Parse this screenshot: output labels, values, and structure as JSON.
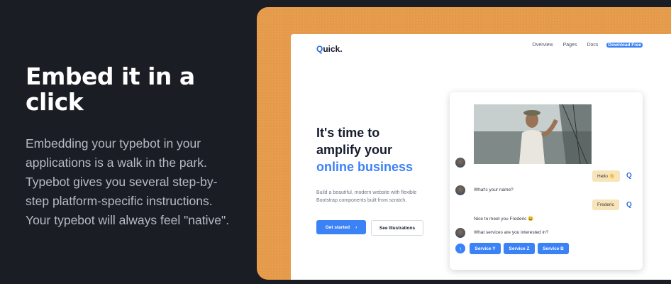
{
  "section": {
    "title": "Embed it in a click",
    "description": "Embedding your typebot in your applications is a walk in the park. Typebot gives you several step-by-step platform-specific instructions. Your typebot will always feel \"native\"."
  },
  "site": {
    "logo_q": "Q",
    "logo_rest": "uick.",
    "nav": {
      "overview": "Overview",
      "pages": "Pages",
      "docs": "Docs",
      "download": "Download Free"
    },
    "hero": {
      "line1": "It's time to",
      "line2": "amplify your",
      "line3": "online business",
      "subtitle": "Build a beautiful, modern website with flexible Bootstrap components built from scratch.",
      "cta_primary": "Get started",
      "cta_primary_arrow": "›",
      "cta_secondary": "See Illustrations"
    }
  },
  "chat": {
    "user_hello": "Hello 👋",
    "bot_question_name": "What's your name?",
    "user_name": "Frederic",
    "bot_greeting": "Nice to meet you Frederic 😀",
    "bot_question_services": "What services are you interested in?",
    "choices": [
      "Service Y",
      "Service Z",
      "Service B"
    ],
    "user_icon_letter": "Q",
    "up_arrow": "↑"
  },
  "colors": {
    "accent": "#3b82f6",
    "frame": "#e59a4a",
    "background": "#1b1d24",
    "user_bubble": "#f7e4ba"
  }
}
